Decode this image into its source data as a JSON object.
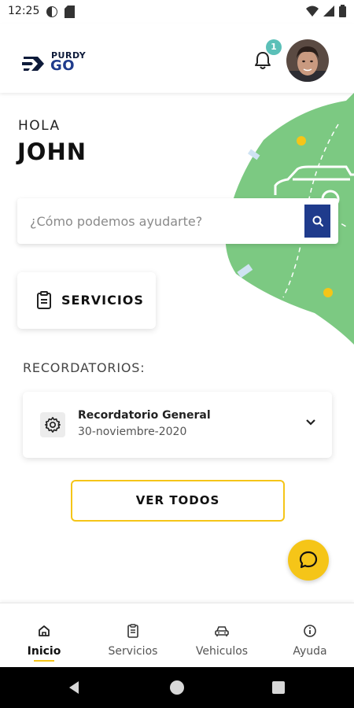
{
  "status_bar": {
    "time": "12:25",
    "left_icons": [
      "data-saver-icon",
      "sd-card-icon"
    ],
    "right_icons": [
      "wifi-icon",
      "signal-icon",
      "battery-icon"
    ]
  },
  "header": {
    "logo": {
      "top_text": "PURDY",
      "bottom_text": "GO"
    },
    "notification_count": "1"
  },
  "greeting": {
    "hello": "HOLA",
    "name": "JOHN"
  },
  "search": {
    "placeholder": "¿Cómo podemos ayudarte?"
  },
  "services_card": {
    "label": "SERVICIOS"
  },
  "reminders": {
    "title": "RECORDATORIOS:",
    "items": [
      {
        "title": "Recordatorio General",
        "date": "30-noviembre-2020"
      }
    ]
  },
  "view_all": {
    "label": "VER TODOS"
  },
  "bottom_nav": {
    "items": [
      {
        "label": "Inicio",
        "icon": "home-icon",
        "active": true
      },
      {
        "label": "Servicios",
        "icon": "clipboard-icon",
        "active": false
      },
      {
        "label": "Vehiculos",
        "icon": "car-icon",
        "active": false
      },
      {
        "label": "Ayuda",
        "icon": "info-icon",
        "active": false
      }
    ]
  },
  "colors": {
    "brand_blue": "#1f3b8c",
    "accent_yellow": "#f5c518",
    "map_green": "#7cc982",
    "badge_teal": "#5bc0b8"
  }
}
